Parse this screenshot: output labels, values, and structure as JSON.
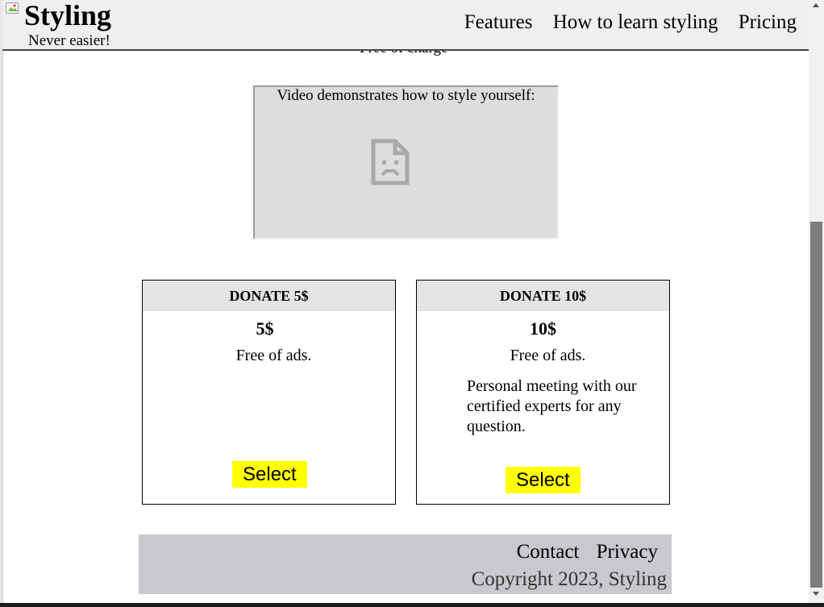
{
  "header": {
    "brand": "Styling",
    "tagline": "Never easier!",
    "nav": [
      "Features",
      "How to learn styling",
      "Pricing"
    ]
  },
  "partially_hidden_text": "Free of charge",
  "video": {
    "caption": "Video demonstrates how to style yourself:",
    "icon": "broken-document-icon"
  },
  "cards": [
    {
      "title": "DONATE 5$",
      "price": "5$",
      "features": [
        "Free of ads."
      ],
      "button": "Select"
    },
    {
      "title": "DONATE 10$",
      "price": "10$",
      "features": [
        "Free of ads.",
        "Personal meeting with our certified experts for any question."
      ],
      "button": "Select"
    }
  ],
  "footer": {
    "links": [
      "Contact",
      "Privacy"
    ],
    "copyright": "Copyright 2023, Styling"
  },
  "colors": {
    "header_bg": "#efefef",
    "card_head_bg": "#e5e4e3",
    "button_bg": "#ffff00",
    "footer_bg": "#c9c8cc"
  }
}
